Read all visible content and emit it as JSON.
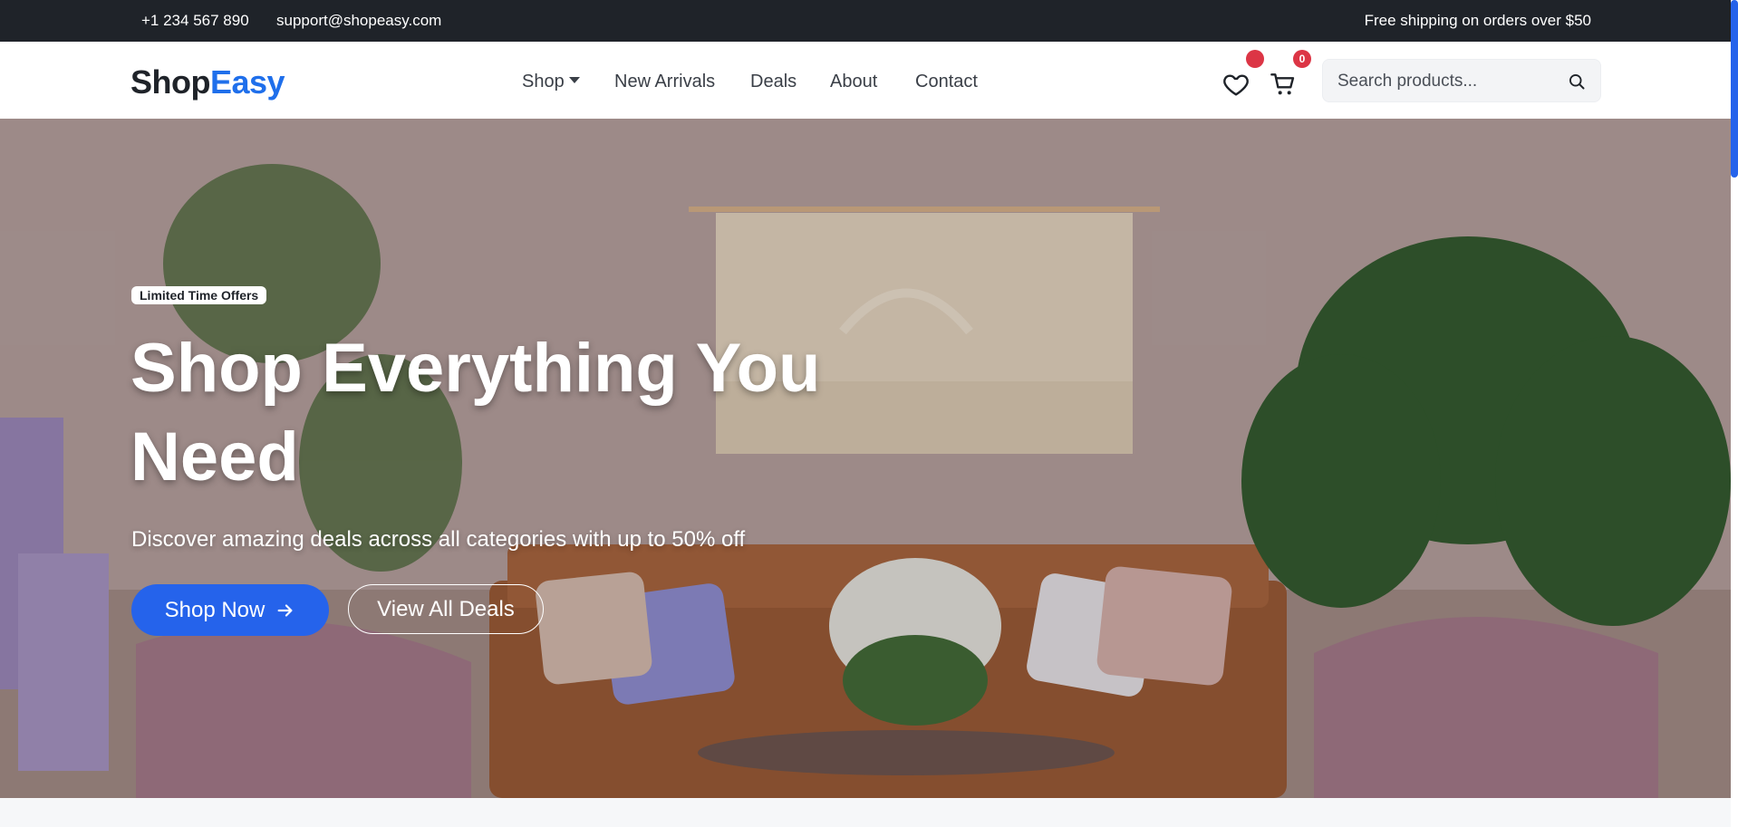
{
  "topbar": {
    "phone": "+1 234 567 890",
    "email": "support@shopeasy.com",
    "promo": "Free shipping on orders over $50"
  },
  "brand": {
    "part1": "Shop",
    "part2": "Easy"
  },
  "nav": {
    "shop": "Shop",
    "new_arrivals": "New Arrivals",
    "deals": "Deals",
    "about": "About",
    "contact": "Contact"
  },
  "icons": {
    "wishlist": "heart-icon",
    "cart": "cart-icon",
    "search": "search-icon"
  },
  "cart": {
    "count": "0"
  },
  "search": {
    "placeholder": "Search products..."
  },
  "hero": {
    "badge": "Limited Time Offers",
    "title": "Shop Everything You Need",
    "subtitle": "Discover amazing deals across all categories with up to 50% off",
    "primary_cta": "Shop Now",
    "secondary_cta": "View All Deals"
  },
  "colors": {
    "accent": "#2563eb",
    "brand_blue": "#1f6feb",
    "badge_red": "#dc3545",
    "topbar": "#1f2329"
  }
}
